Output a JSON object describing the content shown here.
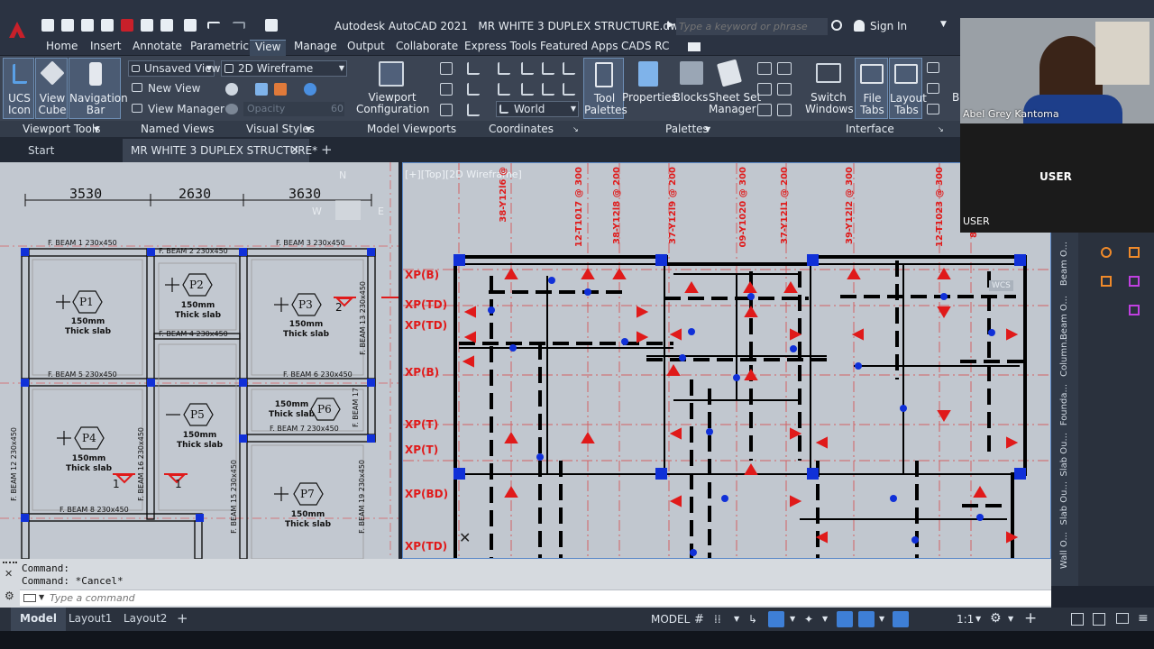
{
  "app": {
    "title": "Autodesk AutoCAD 2021",
    "file": "MR WHITE 3 DUPLEX STRUCTURE.dwg",
    "search_placeholder": "Type a keyword or phrase",
    "sign_in": "Sign In"
  },
  "ribbon_tabs": [
    "Home",
    "Insert",
    "Annotate",
    "Parametric",
    "View",
    "Manage",
    "Output",
    "Collaborate",
    "Express Tools",
    "Featured Apps",
    "CADS RC"
  ],
  "ribbon": {
    "ucs_icon": "UCS\nIcon",
    "view_cube": "View\nCube",
    "nav_bar": "Navigation\nBar",
    "unsaved_view": "Unsaved View",
    "new_view": "New View",
    "view_manager": "View Manager",
    "visual_style": "2D Wireframe",
    "opacity": "Opacity",
    "opacity_val": "60",
    "viewport_config": "Viewport\nConfiguration",
    "world": "World",
    "tool_palettes": "Tool\nPalettes",
    "properties": "Properties",
    "blocks": "Blocks",
    "sheet_set": "Sheet Set\nManager",
    "switch_windows": "Switch\nWindows",
    "file_tabs": "File\nTabs",
    "layout_tabs": "Layout\nTabs",
    "b_cut": "B"
  },
  "panels": [
    "Viewport Tools",
    "Named Views",
    "Visual Styles",
    "Model Viewports",
    "Coordinates",
    "Palettes",
    "Interface"
  ],
  "doc_tabs": {
    "start": "Start",
    "current": "MR WHITE 3 DUPLEX STRUCTURE*"
  },
  "left_drawing": {
    "dims": [
      "3530",
      "2630",
      "3630"
    ],
    "beams": [
      "F. BEAM 1 230x450",
      "F. BEAM 2 230x450",
      "F. BEAM 3 230x450",
      "F. BEAM 4 230x450",
      "F. BEAM 5 230x450",
      "F. BEAM 6 230x450",
      "F. BEAM 7 230x450",
      "F. BEAM 8 230x450",
      "F. BEAM 13 230x450",
      "F. BEAM 17",
      "F. BEAM 12 230x450",
      "F. BEAM 16 230x450",
      "F. BEAM 15 230x450",
      "F. BEAM 19 230x450"
    ],
    "panels": [
      {
        "id": "P1",
        "text": "150mm\nThick slab"
      },
      {
        "id": "P2",
        "text": "150mm\nThick slab"
      },
      {
        "id": "P3",
        "text": "150mm\nThick slab"
      },
      {
        "id": "P4",
        "text": "150mm\nThick slab"
      },
      {
        "id": "P5",
        "text": "150mm\nThick slab"
      },
      {
        "id": "P6",
        "text": "150mm\nThick slab"
      },
      {
        "id": "P7",
        "text": "150mm\nThick slab"
      }
    ],
    "marks": [
      "1",
      "1",
      "2"
    ]
  },
  "right_drawing": {
    "viewport_label": "[+][Top][2D Wireframe]",
    "column_labels": [
      "38-Y12l6 @",
      "12-T1017 @ 300",
      "38-Y12l8 @ 200",
      "37-Y12l9 @ 200",
      "09-Y1020 @ 300",
      "37-Y12l1 @ 200",
      "39-Y12l2 @ 300",
      "12-T1023 @ 300",
      "8"
    ],
    "row_labels": [
      "XP(B)",
      "XP(TD)",
      "XP(TD)",
      "XP(B)",
      "XP(T)",
      "XP(T)",
      "XP(BD)",
      "XP(TD)"
    ],
    "wcs": "WCS"
  },
  "command": {
    "line1": "Command:",
    "line2": "Command: *Cancel*",
    "placeholder": "Type a command"
  },
  "layout_tabs": [
    "Model",
    "Layout1",
    "Layout2"
  ],
  "status": {
    "model": "MODEL",
    "scale": "1:1"
  },
  "side_palette": [
    "Beam O...",
    "Beam O...",
    "Column...",
    "Founda...",
    "Slab Ou...",
    "Slab Ou...",
    "Wall O..."
  ],
  "video": {
    "presenter": "Abel Grey Kantoma",
    "user_center": "USER",
    "user_corner": "USER"
  },
  "colors": {
    "accent": "#3e7fd6",
    "logo": "#c8202a",
    "structure_red": "#e01a1a",
    "node_blue": "#1030d8"
  }
}
